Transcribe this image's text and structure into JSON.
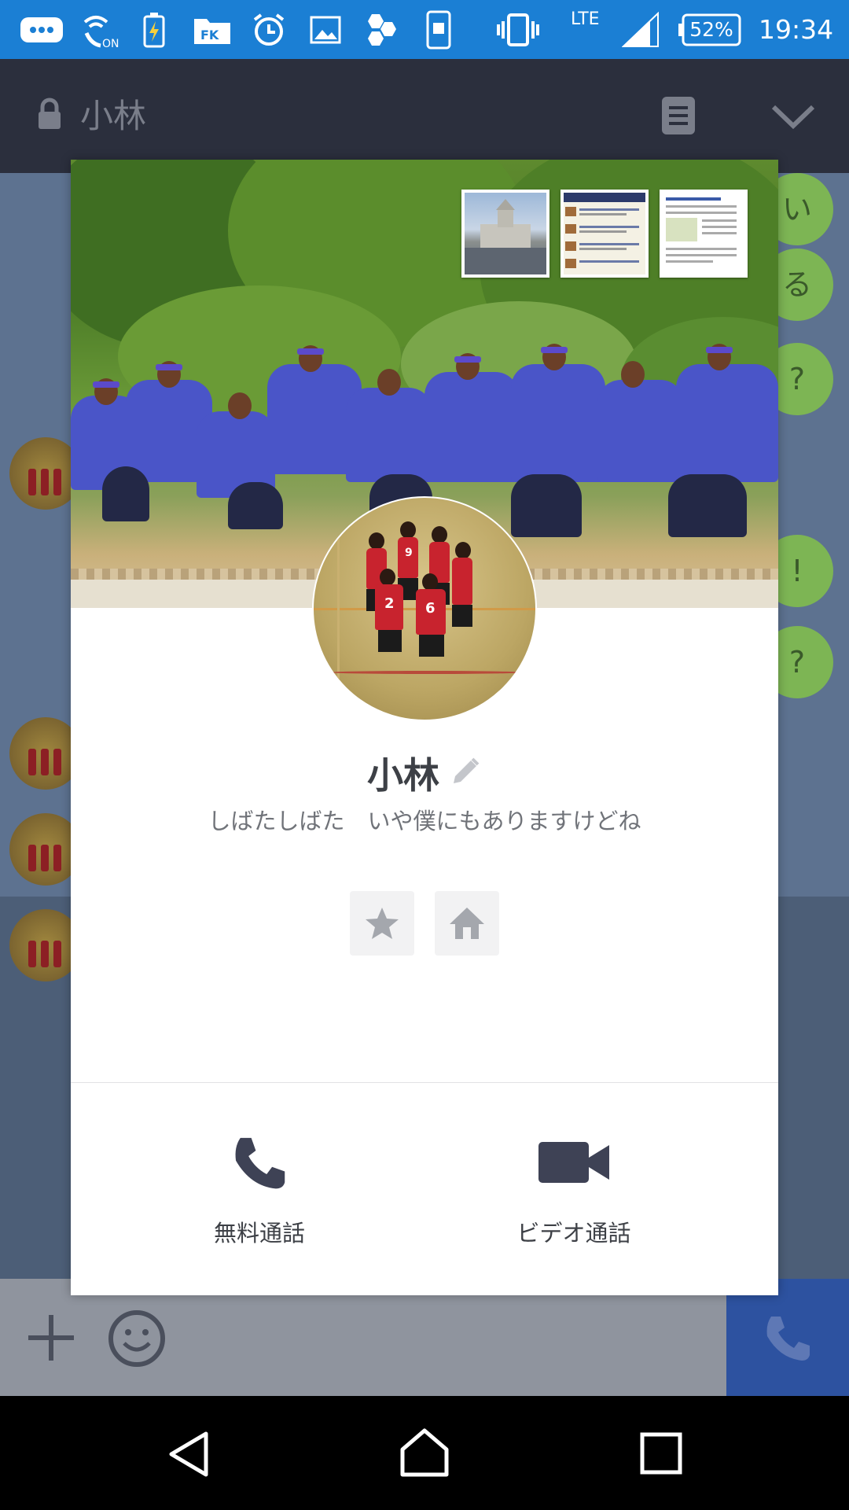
{
  "status_bar": {
    "network": "LTE",
    "battery": "52%",
    "time": "19:34"
  },
  "chat": {
    "title": "小林",
    "bubbles": [
      "い",
      "る",
      "?",
      "!",
      "?"
    ]
  },
  "profile": {
    "name": "小林",
    "status_message": "しばたしばた　いや僕にもありますけどね",
    "actions": {
      "free_call": "無料通話",
      "video_call": "ビデオ通話"
    }
  },
  "colors": {
    "status_bar": "#1b7fd4",
    "chat_bubble": "#7db554",
    "call_button": "#2d52a0",
    "icon_dark": "#3e4255"
  }
}
